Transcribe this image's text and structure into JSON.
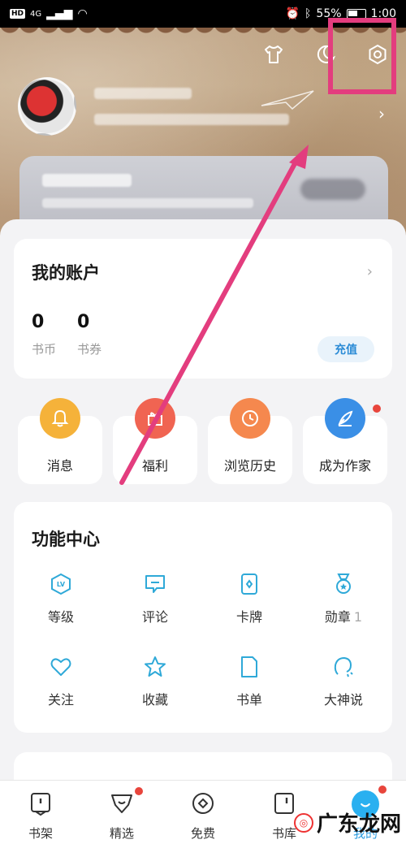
{
  "status_bar": {
    "left_tag": "HD",
    "network": "4G",
    "battery": "55%",
    "time": "1:00"
  },
  "header": {
    "top_icons": [
      "shirt-icon",
      "moon-icon",
      "gear-icon"
    ],
    "profile_chevron": "›"
  },
  "account": {
    "title": "我的账户",
    "chevron": "›",
    "coins_value": "0",
    "coins_label": "书币",
    "coupons_value": "0",
    "coupons_label": "书券",
    "recharge_label": "充值"
  },
  "quick_actions": [
    {
      "label": "消息",
      "icon": "bell-icon",
      "color": "#f5a623"
    },
    {
      "label": "福利",
      "icon": "gift-icon",
      "color": "#f06452"
    },
    {
      "label": "浏览历史",
      "icon": "clock-icon",
      "color": "#f5884e"
    },
    {
      "label": "成为作家",
      "icon": "pen-icon",
      "color": "#3a8fe6",
      "badge": true
    }
  ],
  "function_center": {
    "title": "功能中心",
    "items": [
      {
        "label": "等级",
        "icon": "level-icon"
      },
      {
        "label": "评论",
        "icon": "comment-icon"
      },
      {
        "label": "卡牌",
        "icon": "card-icon"
      },
      {
        "label": "勋章",
        "icon": "medal-icon",
        "count": "1"
      },
      {
        "label": "关注",
        "icon": "heart-icon"
      },
      {
        "label": "收藏",
        "icon": "star-icon"
      },
      {
        "label": "书单",
        "icon": "booklist-icon"
      },
      {
        "label": "大神说",
        "icon": "speech-icon"
      }
    ]
  },
  "bottom_nav": [
    {
      "label": "书架",
      "icon": "bookshelf-icon"
    },
    {
      "label": "精选",
      "icon": "featured-icon",
      "badge": true
    },
    {
      "label": "免费",
      "icon": "free-icon"
    },
    {
      "label": "书库",
      "icon": "library-icon"
    },
    {
      "label": "我的",
      "icon": "profile-icon",
      "active": true,
      "badge": true
    }
  ],
  "watermark": {
    "text": "广东龙网"
  },
  "colors": {
    "accent_blue": "#2a9be0",
    "highlight_pink": "#e33d7e",
    "icon_teal": "#2fa9d8"
  }
}
